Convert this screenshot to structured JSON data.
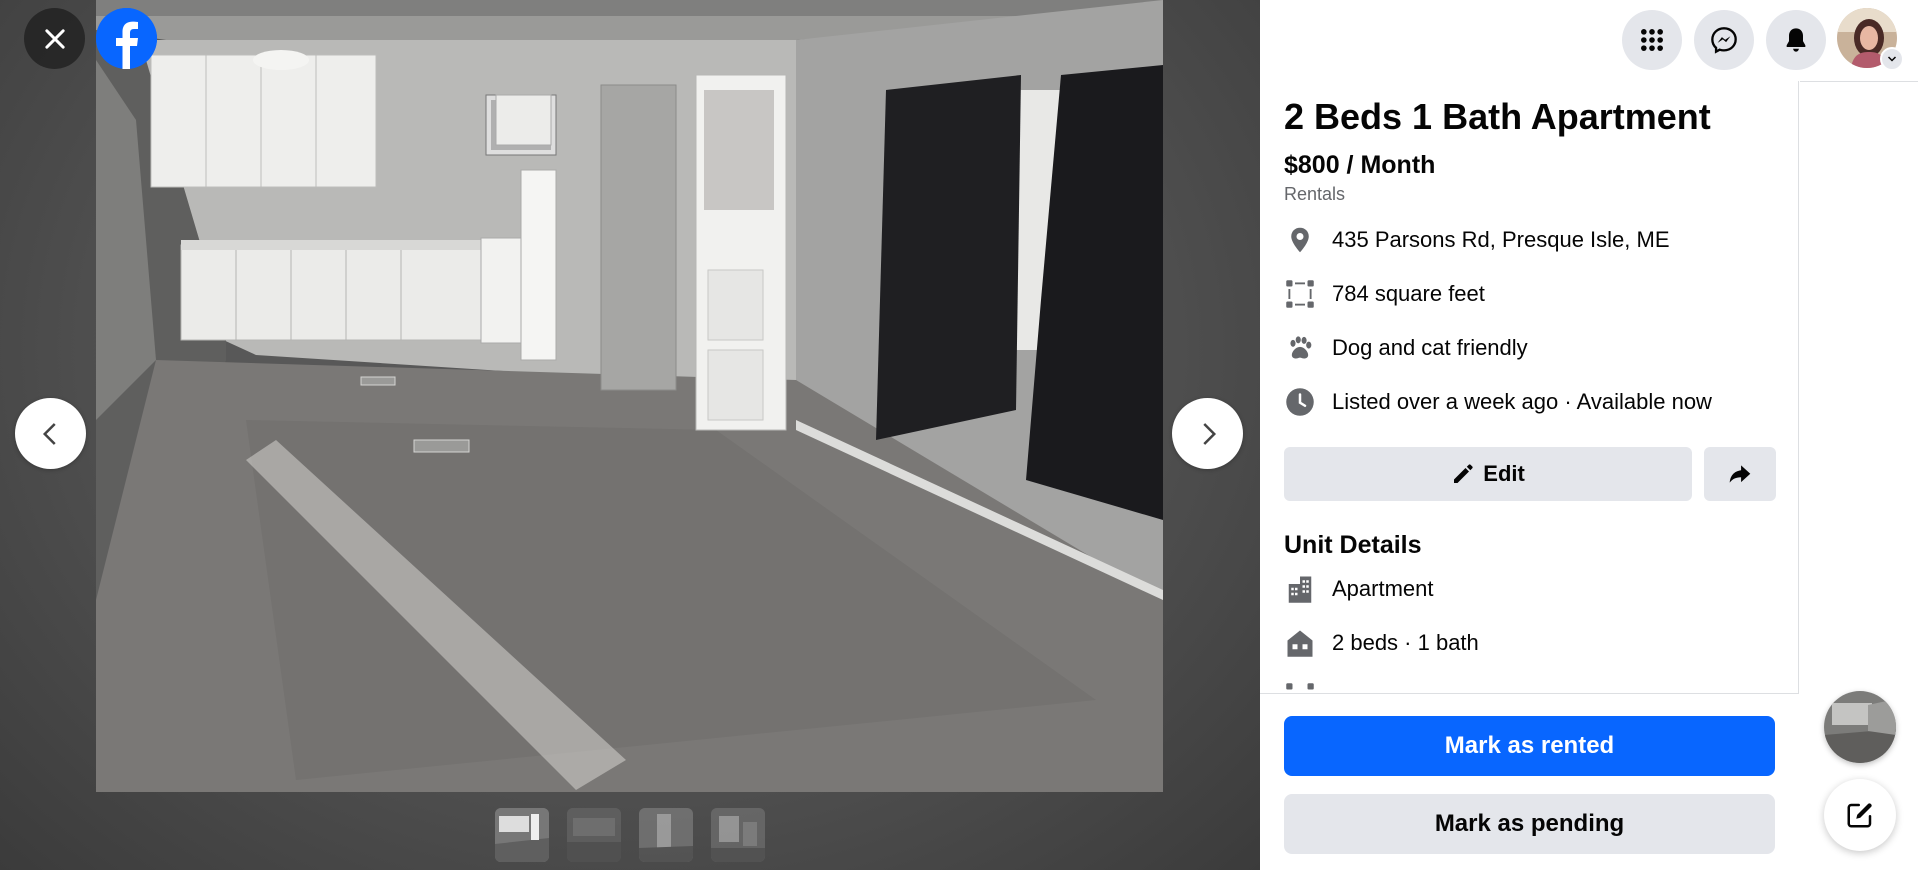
{
  "viewer": {
    "close_icon": "close-icon",
    "logo_icon": "facebook-logo-icon",
    "prev_icon": "chevron-left-icon",
    "next_icon": "chevron-right-icon",
    "photo_count": 4,
    "active_photo": 1
  },
  "topbar": {
    "icons": [
      "menu-grid-icon",
      "messenger-icon",
      "notifications-bell-icon",
      "account-avatar"
    ]
  },
  "listing": {
    "title": "2 Beds 1 Bath Apartment",
    "price": "$800 / Month",
    "category": "Rentals",
    "details": [
      {
        "icon": "location-pin-icon",
        "text": "435 Parsons Rd, Presque Isle, ME"
      },
      {
        "icon": "square-feet-icon",
        "text": "784 square feet"
      },
      {
        "icon": "paw-icon",
        "text": "Dog and cat friendly"
      },
      {
        "icon": "clock-icon",
        "text": "Listed over a week ago · Available now"
      }
    ],
    "edit_label": "Edit",
    "share_icon": "share-icon"
  },
  "unit_details": {
    "title": "Unit Details",
    "items": [
      {
        "icon": "building-icon",
        "text": "Apartment"
      },
      {
        "icon": "home-icon",
        "text": "2 beds · 1 bath"
      }
    ]
  },
  "actions": {
    "mark_rented": "Mark as rented",
    "mark_pending": "Mark as pending"
  },
  "colors": {
    "primary": "#0866ff",
    "button_gray": "#e4e6eb",
    "text": "#050505",
    "secondary_text": "#65676b"
  }
}
